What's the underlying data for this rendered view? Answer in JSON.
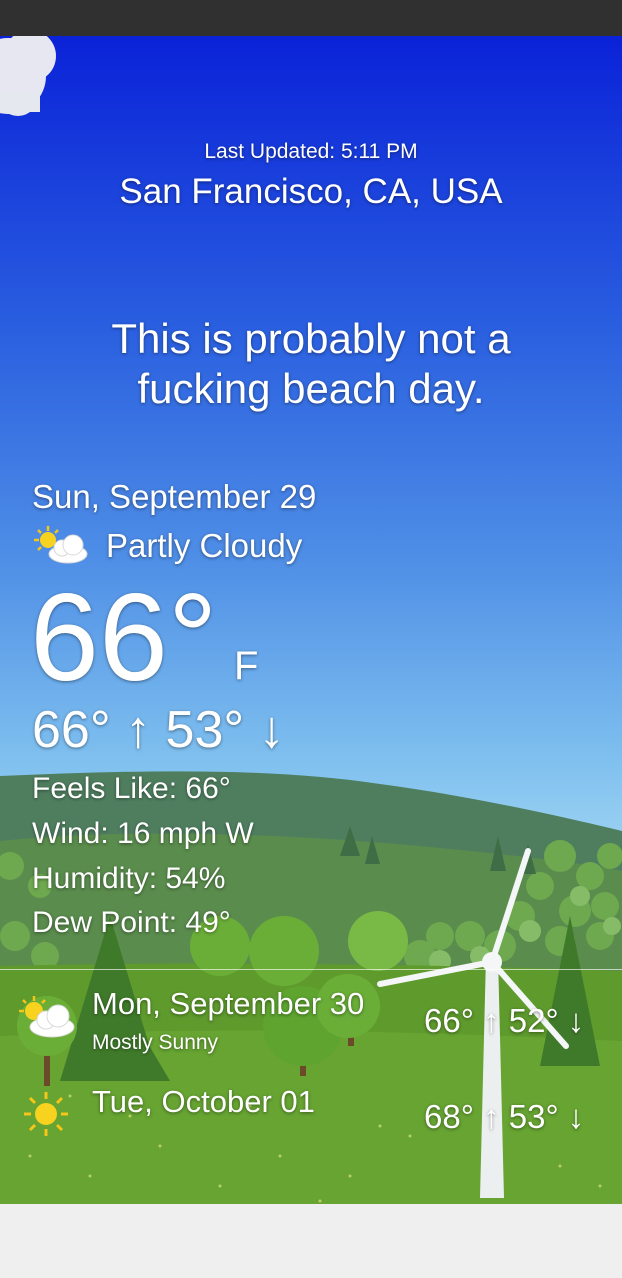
{
  "header": {
    "last_updated": "Last Updated: 5:11 PM",
    "location": "San Francisco, CA, USA"
  },
  "quip": "This is probably not a fucking beach day.",
  "current": {
    "date": "Sun, September 29",
    "condition": "Partly Cloudy",
    "condition_icon": "partly-cloudy-icon",
    "temperature": "66°",
    "unit": "F",
    "hi_lo": "66° ↑ 53° ↓",
    "feels_like": "Feels Like: 66°",
    "wind": "Wind: 16 mph W",
    "humidity": "Humidity: 54%",
    "dew_point": "Dew Point: 49°"
  },
  "forecast": [
    {
      "day": "Mon, September 30",
      "condition": "Mostly Sunny",
      "hi_lo": "66° ↑ 52° ↓",
      "icon": "mostly-sunny-icon"
    },
    {
      "day": "Tue, October 01",
      "condition": "",
      "hi_lo": "68° ↑ 53° ↓",
      "icon": "sunny-icon"
    }
  ],
  "colors": {
    "sky_top": "#0a22d8",
    "sky_bottom": "#a6d8f3",
    "grass": "#5e9a2c",
    "status_bar": "#303030"
  }
}
